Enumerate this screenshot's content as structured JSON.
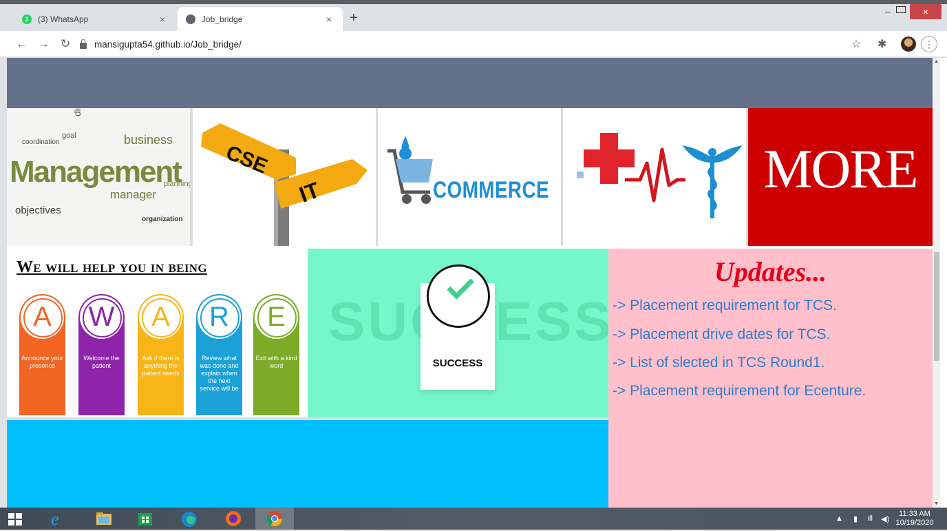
{
  "browser": {
    "tabs": [
      {
        "title": "(3) WhatsApp",
        "badge": "3",
        "active": false
      },
      {
        "title": "Job_bridge",
        "active": true
      }
    ],
    "new_tab_label": "+",
    "url": "mansigupta54.github.io/Job_bridge/",
    "close_glyph": "×"
  },
  "categories": [
    {
      "name": "management-card",
      "words": [
        "Management",
        "business",
        "objectives",
        "manager",
        "director",
        "coordination",
        "goal",
        "planning",
        "organization"
      ]
    },
    {
      "name": "cse-it-card",
      "sign1": "CSE",
      "sign2": "IT"
    },
    {
      "name": "commerce-card",
      "label": "COMMERCE"
    },
    {
      "name": "medical-card"
    },
    {
      "name": "more-card",
      "label": "MORE",
      "color": "#cc0000"
    }
  ],
  "aware": {
    "title": "We will help you in being",
    "items": [
      {
        "letter": "A",
        "text": "Announce your presence",
        "color": "#f26522"
      },
      {
        "letter": "W",
        "text": "Welcome the patient",
        "color": "#8e24aa"
      },
      {
        "letter": "A",
        "text": "Ask if there is anything the patient needs",
        "color": "#f7b518"
      },
      {
        "letter": "R",
        "text": "Review what was done and explain when the next service will be",
        "color": "#1ba1d8"
      },
      {
        "letter": "E",
        "text": "Exit with a kind word",
        "color": "#7cab27"
      }
    ]
  },
  "success": {
    "background_word": "SUCCESS",
    "label": "SUCCESS"
  },
  "updates": {
    "title": "Updates...",
    "items": [
      "-> Placement requirement for TCS.",
      "-> Placement drive dates for TCS.",
      "-> List of slected in TCS Round1.",
      "-> Placement requirement for Ecenture."
    ]
  },
  "colors": {
    "header_band": "#64718b",
    "success_bg": "#76f7cb",
    "updates_bg": "#ffc0cb",
    "bottom_band": "#00bfff"
  },
  "taskbar": {
    "time": "11:33 AM",
    "date": "10/19/2020"
  }
}
